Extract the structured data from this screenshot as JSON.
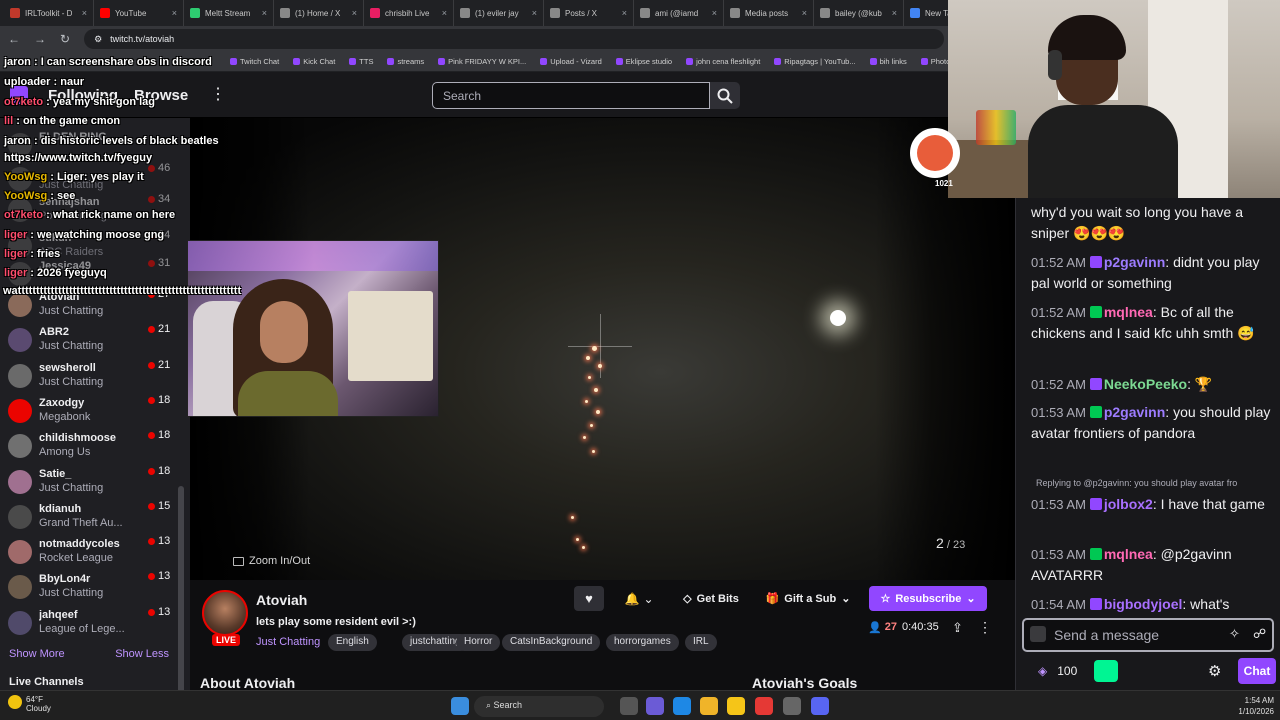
{
  "browser": {
    "tabs": [
      {
        "title": "IRLToolkit - D",
        "color": "#c0392b"
      },
      {
        "title": "YouTube",
        "color": "#ff0000"
      },
      {
        "title": "Meltt Stream",
        "color": "#2ecc71"
      },
      {
        "title": "(1) Home / X",
        "color": "#888888"
      },
      {
        "title": "chrisbih Live",
        "color": "#e91e63"
      },
      {
        "title": "(1) eviler jay",
        "color": "#888888"
      },
      {
        "title": "Posts / X",
        "color": "#888888"
      },
      {
        "title": "ami (@iamd",
        "color": "#888888"
      },
      {
        "title": "Media posts",
        "color": "#888888"
      },
      {
        "title": "bailey (@kub",
        "color": "#888888"
      },
      {
        "title": "New Tab",
        "color": "#4285f4"
      }
    ],
    "url": "twitch.tv/atoviah",
    "bookmarks": [
      "Twitch Chat",
      "Kick Chat",
      "TTS",
      "streams",
      "Pink FRIDAYY W KPI...",
      "Upload - Vizard",
      "Eklipse studio",
      "john cena fleshlight",
      "Ripagtags | YouTub...",
      "bih links",
      "Photop"
    ]
  },
  "nav": {
    "following": "Following",
    "browse": "Browse",
    "search_placeholder": "Search"
  },
  "sidebar": {
    "channels": [
      {
        "name": "",
        "game": "",
        "count": "",
        "top": 0
      },
      {
        "name": "Atovian",
        "game": "Just Chatting",
        "count": "27"
      },
      {
        "name": "ABR2",
        "game": "Just Chatting",
        "count": "21"
      },
      {
        "name": "sewsheroll",
        "game": "Just Chatting",
        "count": "21"
      },
      {
        "name": "Zaxodgy",
        "game": "Megabonk",
        "count": "18"
      },
      {
        "name": "childishmoose",
        "game": "Among Us",
        "count": "18"
      },
      {
        "name": "Satie_",
        "game": "Just Chatting",
        "count": "18"
      },
      {
        "name": "kdianuh",
        "game": "Grand Theft Au...",
        "count": "15"
      },
      {
        "name": "notmaddycoles",
        "game": "Rocket League",
        "count": "13"
      },
      {
        "name": "BbyLon4r",
        "game": "Just Chatting",
        "count": "13"
      },
      {
        "name": "jahqeef",
        "game": "League of Lege...",
        "count": "13"
      }
    ],
    "hidden_rows": [
      {
        "name": "ELDEN RING",
        "game": ""
      },
      {
        "name": "",
        "game": "Just Chatting",
        "count": "46"
      },
      {
        "name": "sennajshan",
        "game": "Pokemon Legen...",
        "count": "34"
      },
      {
        "name": "stikuh",
        "game": "ARC Raiders",
        "count": "34"
      },
      {
        "name": "Jessica49",
        "game": "",
        "count": "31"
      }
    ],
    "show_more": "Show More",
    "show_less": "Show Less",
    "live_channels": "Live Channels"
  },
  "overlay_chat": [
    {
      "user": "jaron",
      "text": "I can screenshare obs in discord",
      "color": "#ffffff"
    },
    {
      "user": "uploader",
      "text": "naur",
      "color": "#ffffff"
    },
    {
      "user": "ot7keto",
      "text": "yea my shit gon lag",
      "color": "#ff4d6d"
    },
    {
      "user": "lil",
      "text": "on the game cmon",
      "color": "#ff4d6d"
    },
    {
      "user": "jaron",
      "text": "dis historic levels of black beatles",
      "color": "#ffffff"
    },
    {
      "user": "",
      "text": "https://www.twitch.tv/fyeguy",
      "color": "#ffffff"
    },
    {
      "user": "YooWsg",
      "text": "Liger: yes play it",
      "color": "#e6b800"
    },
    {
      "user": "YooWsg",
      "text": "see",
      "color": "#e6b800"
    },
    {
      "user": "ot7keto",
      "text": "what rick name on here",
      "color": "#ff4d6d"
    },
    {
      "user": "liger",
      "text": "we watching moose gng",
      "color": "#ff4d6d"
    },
    {
      "user": "liger",
      "text": "fries",
      "color": "#ff4d6d"
    },
    {
      "user": "liger",
      "text": "2026 fyeguyq",
      "color": "#ff4d6d"
    },
    {
      "user": "",
      "text": "wattttttttttttttttttttttttttttttttttttttttttttttttttttttttttttt",
      "color": "#ffffff"
    }
  ],
  "video": {
    "zoom_hint": "Zoom In/Out",
    "page_current": "2",
    "page_total": "23",
    "sticker_count": "1021"
  },
  "stream": {
    "name": "Atoviah",
    "title": "lets play some resident evil >:)",
    "live_label": "LIVE",
    "category": "Just Chatting",
    "tags": [
      "English",
      "justchatting",
      "Horror",
      "CatsInBackground",
      "horrorgames",
      "IRL"
    ],
    "viewers": "27",
    "uptime": "0:40:35",
    "get_bits": "Get Bits",
    "gift_sub": "Gift a Sub",
    "resubscribe": "Resubscribe",
    "about": "About Atoviah",
    "goals": "Atoviah's Goals"
  },
  "chat": {
    "messages": [
      {
        "ts": "",
        "user": "",
        "text": "why'd you wait so long you have a sniper 😍😍😍",
        "color": "#efeff1"
      },
      {
        "ts": "01:52 AM",
        "user": "p2gavinn",
        "text": ": didnt you play pal world or something",
        "color": "#9d7cff"
      },
      {
        "ts": "01:52 AM",
        "user": "mqlnea",
        "text": ": Bc of all the chickens and I said kfc uhh smth 😅",
        "color": "#ff69b4"
      },
      {
        "ts": "01:52 AM",
        "user": "NeekoPeeko",
        "text": ": 🏆",
        "color": "#7cd992"
      },
      {
        "ts": "01:53 AM",
        "user": "p2gavinn",
        "text": ": you should play avatar frontiers of pandora",
        "color": "#9d7cff"
      },
      {
        "ts": "01:53 AM",
        "user": "jolbox2",
        "text": ": I have that game",
        "color": "#a970ff"
      },
      {
        "ts": "01:53 AM",
        "user": "mqlnea",
        "text": ": @p2gavinn AVATARRR",
        "color": "#ff69b4"
      },
      {
        "ts": "01:54 AM",
        "user": "bigbodyjoel",
        "text": ": what's",
        "color": "#a970ff"
      }
    ],
    "reply_context": "Replying to @p2gavinn: you should play avatar fro",
    "input_placeholder": "Send a message",
    "points": "100",
    "chat_button": "Chat"
  },
  "taskbar": {
    "temp": "64°F",
    "condition": "Cloudy",
    "search": "Search",
    "time": "1:54 AM",
    "date": "1/10/2026"
  }
}
